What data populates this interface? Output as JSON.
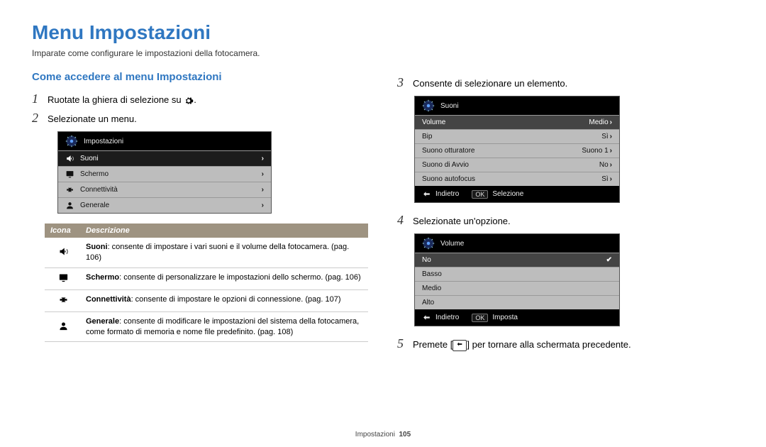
{
  "title": "Menu Impostazioni",
  "intro": "Imparate come configurare le impostazioni della fotocamera.",
  "section_title": "Come accedere al menu Impostazioni",
  "steps": {
    "s1": "Ruotate la ghiera di selezione su",
    "s1_end": ".",
    "s2": "Selezionate un menu.",
    "s3": "Consente di selezionare un elemento.",
    "s4": "Selezionate un'opzione.",
    "s5_pre": "Premete [",
    "s5_post": "] per tornare alla schermata precedente."
  },
  "cam1": {
    "header": "Impostazioni",
    "rows": [
      {
        "label": "Suoni",
        "selected": true
      },
      {
        "label": "Schermo"
      },
      {
        "label": "Connettività"
      },
      {
        "label": "Generale"
      }
    ]
  },
  "cam2": {
    "header": "Suoni",
    "rows": [
      {
        "label": "Volume",
        "value": "Medio",
        "selected": true
      },
      {
        "label": "Bip",
        "value": "Sì"
      },
      {
        "label": "Suono otturatore",
        "value": "Suono 1"
      },
      {
        "label": "Suono di Avvio",
        "value": "No"
      },
      {
        "label": "Suono autofocus",
        "value": "Sì"
      }
    ],
    "footer": {
      "back": "Indietro",
      "ok_label": "Selezione",
      "ok_key": "OK"
    }
  },
  "cam3": {
    "header": "Volume",
    "rows": [
      {
        "label": "No",
        "selected": true,
        "check": true
      },
      {
        "label": "Basso"
      },
      {
        "label": "Medio"
      },
      {
        "label": "Alto"
      }
    ],
    "footer": {
      "back": "Indietro",
      "ok_label": "Imposta",
      "ok_key": "OK"
    }
  },
  "table": {
    "head_icon": "Icona",
    "head_desc": "Descrizione",
    "rows": [
      {
        "b": "Suoni",
        "t": ": consente di impostare i vari suoni e il volume della fotocamera. (pag. 106)"
      },
      {
        "b": "Schermo",
        "t": ": consente di personalizzare le impostazioni dello schermo. (pag. 106)"
      },
      {
        "b": "Connettività",
        "t": ": consente di impostare le opzioni di connessione. (pag. 107)"
      },
      {
        "b": "Generale",
        "t": ": consente di modificare le impostazioni del sistema della fotocamera, come formato di memoria e nome file predefinito. (pag. 108)"
      }
    ]
  },
  "footer": {
    "section": "Impostazioni",
    "page": "105"
  }
}
